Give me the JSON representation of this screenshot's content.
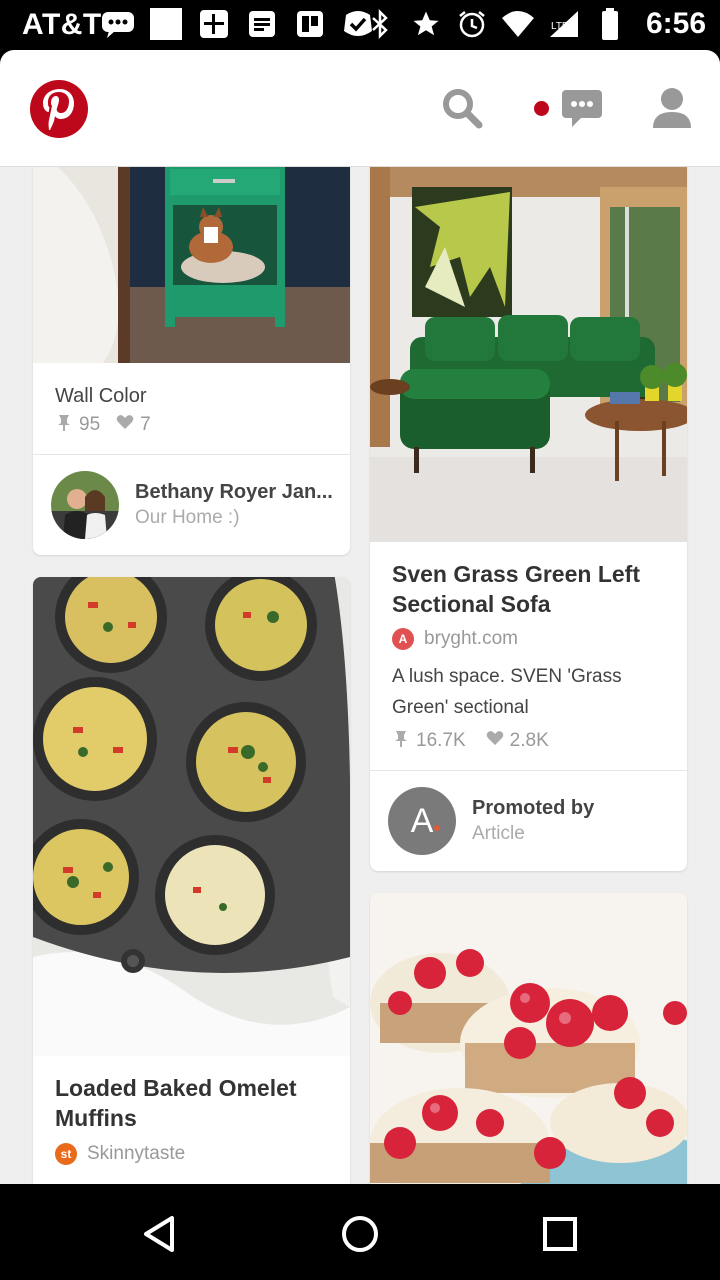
{
  "status_bar": {
    "carrier": "AT&T",
    "time": "6:56",
    "icons": [
      "messages-icon",
      "blank-app-icon",
      "calculator-icon",
      "docs-icon",
      "trello-icon",
      "tasks-icon",
      "bluetooth-icon",
      "star-icon",
      "alarm-icon",
      "wifi-icon",
      "signal-icon",
      "battery-icon"
    ]
  },
  "header": {
    "logo": "pinterest-logo",
    "icons": [
      "search-icon",
      "notification-dot",
      "messages-icon",
      "profile-icon"
    ],
    "brand_color": "#bd081c"
  },
  "feed": {
    "left_column": [
      {
        "title": "Wall Color",
        "saves": "95",
        "likes": "7",
        "pinner_name": "Bethany Royer Jan...",
        "board": "Our Home :)"
      },
      {
        "title": "Loaded Baked Omelet Muffins",
        "source_icon_text": "st",
        "source": "Skinnytaste",
        "source_color": "#e86a1a"
      }
    ],
    "right_column": [
      {
        "title": "Sven Grass Green Left Sectional Sofa",
        "source_icon_text": "A",
        "source": "bryght.com",
        "source_color": "#e05252",
        "description": "A lush space. SVEN 'Grass Green' sectional",
        "saves": "16.7K",
        "likes": "2.8K",
        "promoted_label": "Promoted by",
        "promoter": "Article",
        "promoter_avatar_text": "A"
      },
      {
        "image": "raspberry-cheesecake-bites"
      }
    ]
  },
  "navbar": {
    "icons": [
      "back-icon",
      "home-icon",
      "recents-icon"
    ]
  }
}
